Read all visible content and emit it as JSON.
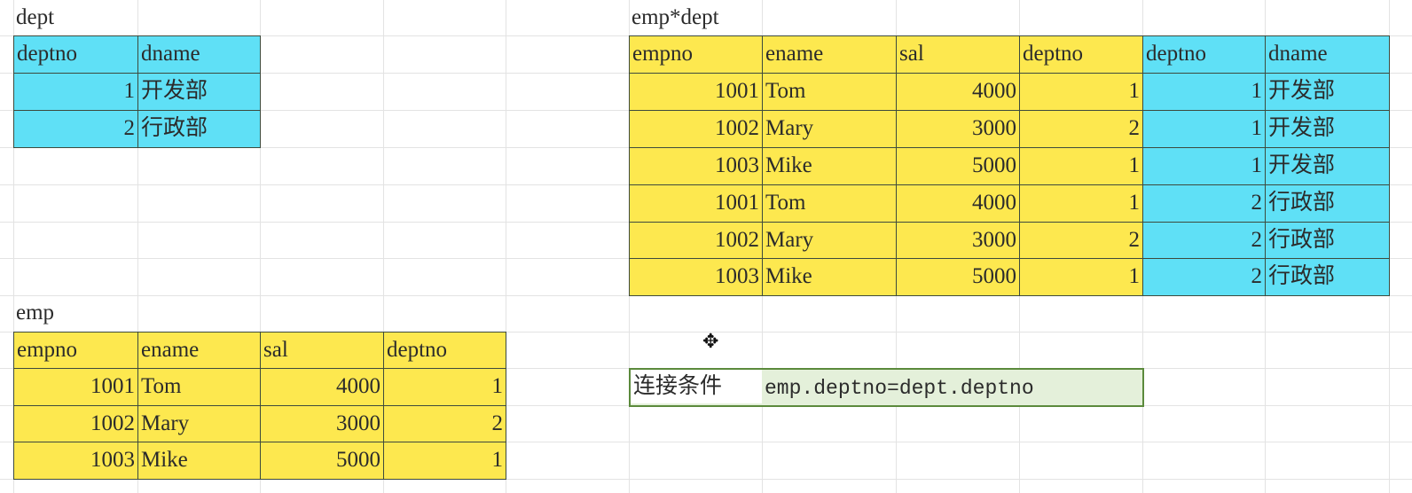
{
  "colors": {
    "emp": "#fde84f",
    "dept": "#5fe0f6",
    "condition": "#e4f0da"
  },
  "dept": {
    "title": "dept",
    "headers": [
      "deptno",
      "dname"
    ],
    "rows": [
      [
        "1",
        "开发部"
      ],
      [
        "2",
        "行政部"
      ]
    ]
  },
  "emp": {
    "title": "emp",
    "headers": [
      "empno",
      "ename",
      "sal",
      "deptno"
    ],
    "rows": [
      [
        "1001",
        "Tom",
        "4000",
        "1"
      ],
      [
        "1002",
        "Mary",
        "3000",
        "2"
      ],
      [
        "1003",
        "Mike",
        "5000",
        "1"
      ]
    ]
  },
  "product": {
    "title": "emp*dept",
    "headers": [
      "empno",
      "ename",
      "sal",
      "deptno",
      "deptno",
      "dname"
    ],
    "rows": [
      [
        "1001",
        "Tom",
        "4000",
        "1",
        "1",
        "开发部"
      ],
      [
        "1002",
        "Mary",
        "3000",
        "2",
        "1",
        "开发部"
      ],
      [
        "1003",
        "Mike",
        "5000",
        "1",
        "1",
        "开发部"
      ],
      [
        "1001",
        "Tom",
        "4000",
        "1",
        "2",
        "行政部"
      ],
      [
        "1002",
        "Mary",
        "3000",
        "2",
        "2",
        "行政部"
      ],
      [
        "1003",
        "Mike",
        "5000",
        "1",
        "2",
        "行政部"
      ]
    ]
  },
  "condition": {
    "label": "连接条件",
    "value": "emp.deptno=dept.deptno"
  },
  "cursor_icon": "move-cursor-icon"
}
